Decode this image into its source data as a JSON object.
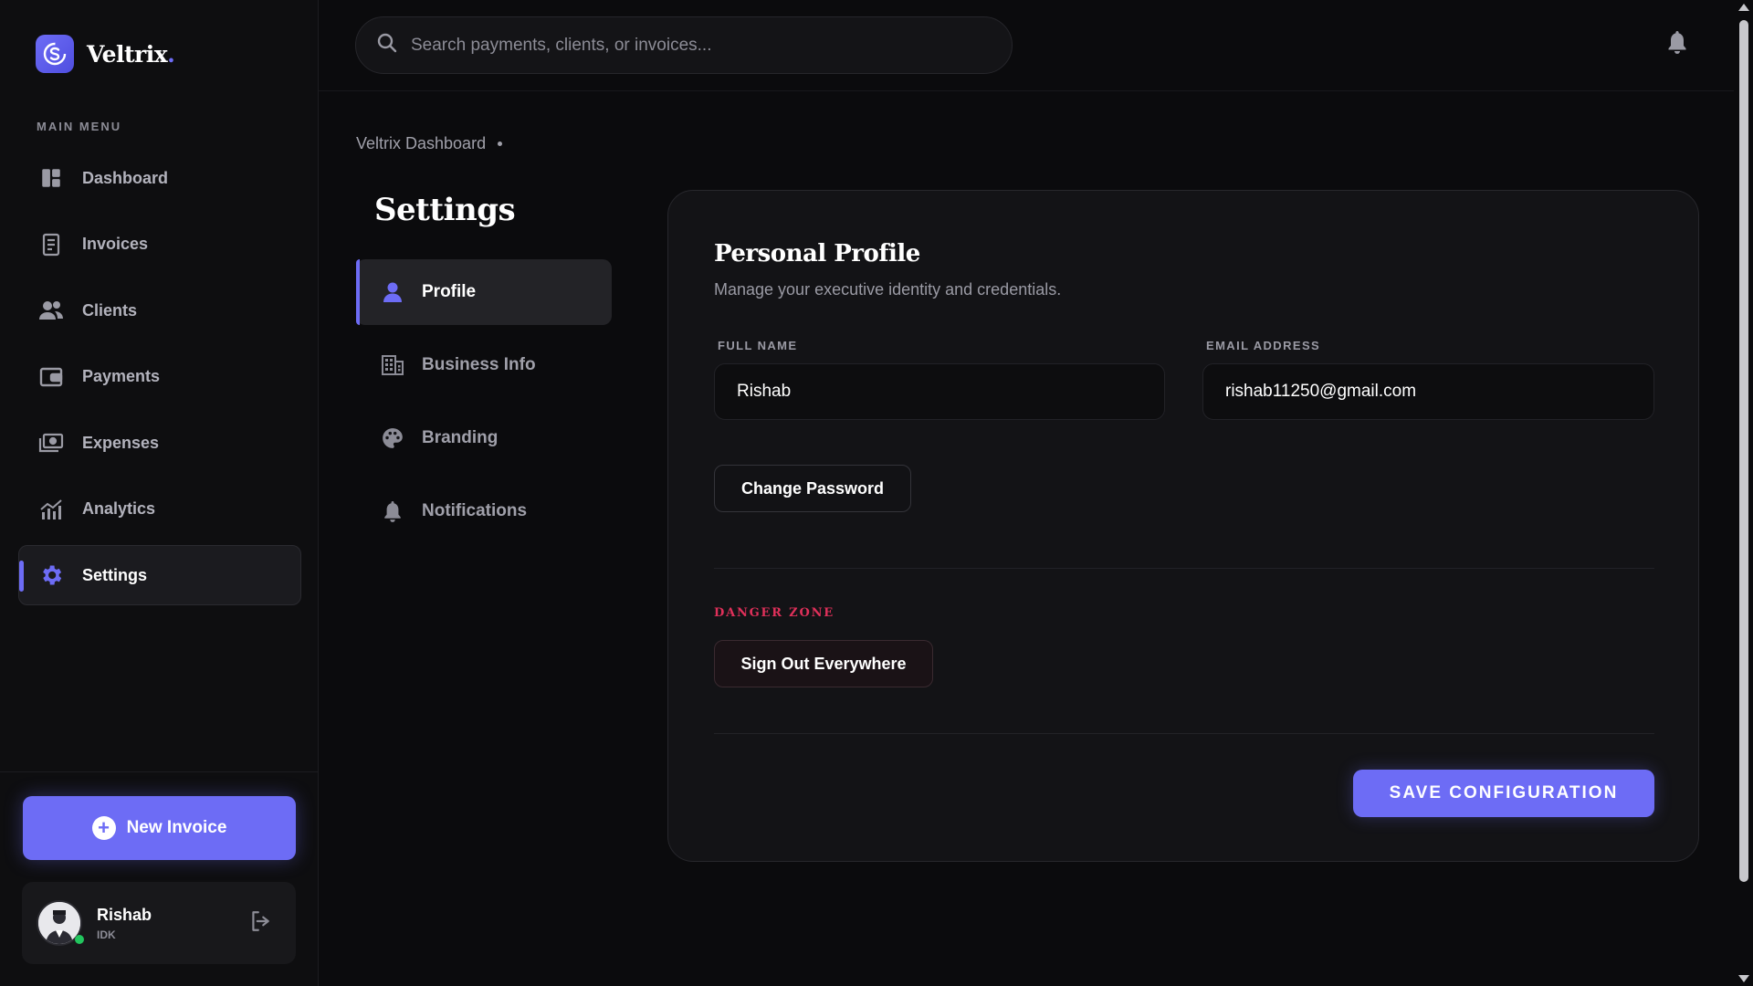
{
  "app": {
    "name": "Veltrix",
    "name_dot": "."
  },
  "sidebar": {
    "menu_title": "MAIN MENU",
    "items": [
      {
        "label": "Dashboard",
        "icon": "dashboard-icon",
        "active": false
      },
      {
        "label": "Invoices",
        "icon": "invoice-icon",
        "active": false
      },
      {
        "label": "Clients",
        "icon": "clients-icon",
        "active": false
      },
      {
        "label": "Payments",
        "icon": "wallet-icon",
        "active": false
      },
      {
        "label": "Expenses",
        "icon": "cash-icon",
        "active": false
      },
      {
        "label": "Analytics",
        "icon": "chart-icon",
        "active": false
      },
      {
        "label": "Settings",
        "icon": "gear-icon",
        "active": true
      }
    ],
    "new_invoice_label": "New Invoice",
    "user": {
      "name": "Rishab",
      "role": "IDK"
    }
  },
  "topbar": {
    "search_placeholder": "Search payments, clients, or invoices..."
  },
  "breadcrumb": {
    "label": "Veltrix Dashboard"
  },
  "settings": {
    "title": "Settings",
    "nav": [
      {
        "label": "Profile",
        "icon": "user-icon",
        "active": true
      },
      {
        "label": "Business Info",
        "icon": "building-icon",
        "active": false
      },
      {
        "label": "Branding",
        "icon": "palette-icon",
        "active": false
      },
      {
        "label": "Notifications",
        "icon": "bell-icon",
        "active": false
      }
    ]
  },
  "profile": {
    "title": "Personal Profile",
    "subtitle": "Manage your executive identity and credentials.",
    "full_name_label": "FULL NAME",
    "full_name_value": "Rishab",
    "email_label": "EMAIL ADDRESS",
    "email_value": "rishab11250@gmail.com",
    "change_password_label": "Change Password",
    "danger_zone_label": "DANGER ZONE",
    "sign_out_label": "Sign Out Everywhere",
    "save_label": "SAVE CONFIGURATION"
  },
  "colors": {
    "accent": "#6d6cf5",
    "danger": "#e0305a",
    "background": "#0b0b0d",
    "online": "#22c55e"
  }
}
